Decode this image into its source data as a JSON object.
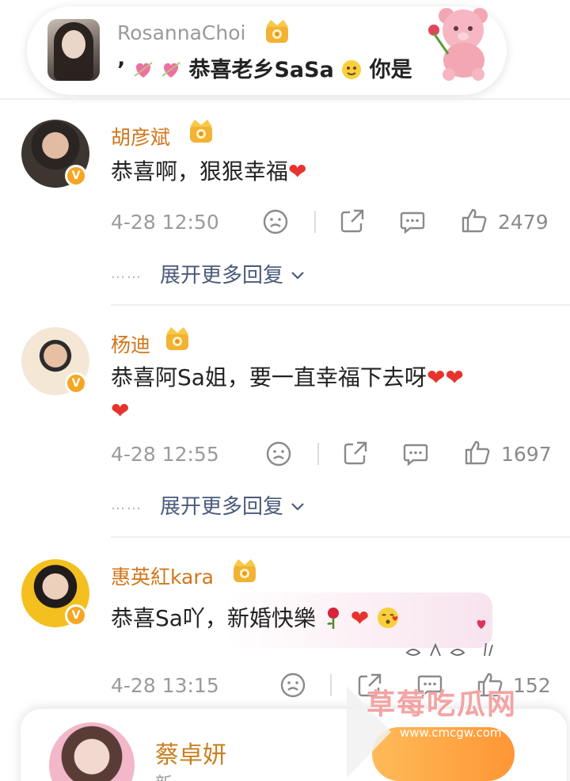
{
  "top_card": {
    "username": "RosannaChoi",
    "message_prefix": "’",
    "message": "恭喜老乡SaSa",
    "message_suffix": "你是"
  },
  "comments": [
    {
      "username": "胡彦斌",
      "text": "恭喜啊，狠狠幸福",
      "hearts": "❤",
      "timestamp": "4-28 12:50",
      "likes": "2479",
      "expand_label": "展开更多回复",
      "expand_dots": "……"
    },
    {
      "username": "杨迪",
      "text": "恭喜阿Sa姐，要一直幸福下去呀",
      "hearts": "❤❤",
      "hearts_line2": "❤",
      "timestamp": "4-28 12:55",
      "likes": "1697",
      "expand_label": "展开更多回复",
      "expand_dots": "……"
    },
    {
      "username": "惠英紅kara",
      "text": "恭喜Sa吖，新婚快樂",
      "timestamp": "4-28 13:15",
      "likes": "152"
    }
  ],
  "bottom_card": {
    "username": "蔡卓妍",
    "subtitle": "新..."
  },
  "watermark": {
    "text": "草莓吃瓜网",
    "url": "www.cmcgw.com"
  },
  "verified_mark": "V",
  "colors": {
    "username": "#d1761b",
    "heart": "#e8322d",
    "meta": "#9b9b9b",
    "link": "#4a5a7a",
    "verified": "#f5a623"
  },
  "icons": [
    "crown-badge-icon",
    "sad-face-icon",
    "share-icon",
    "comment-icon",
    "thumbs-up-icon",
    "chevron-down-icon",
    "teddy-bear-sticker",
    "rose-icon",
    "heart-icon"
  ]
}
